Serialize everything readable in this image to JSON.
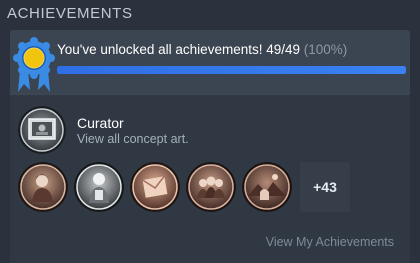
{
  "section": {
    "title": "ACHIEVEMENTS"
  },
  "summary": {
    "unlocked_text": "You've unlocked all achievements! 49/49",
    "percent_text": "(100%)",
    "progress_fraction": 1.0,
    "progress_color": "#3b81f3",
    "ribbon_color": "#3a8be3",
    "medal_color": "#f1c40f"
  },
  "featured": {
    "name": "Curator",
    "description": "View all concept art.",
    "icon": "framed-painting-icon"
  },
  "achievement_icons": [
    {
      "icon": "portrait-lady-icon"
    },
    {
      "icon": "portrait-figure-icon"
    },
    {
      "icon": "envelope-card-icon"
    },
    {
      "icon": "group-figures-icon"
    },
    {
      "icon": "landscape-scene-icon"
    }
  ],
  "more": {
    "label": "+43"
  },
  "footer": {
    "link_label": "View My Achievements"
  },
  "colors": {
    "background": "#2b323d",
    "panel": "#303843",
    "header": "#3b4451",
    "link": "#7d8b98"
  }
}
